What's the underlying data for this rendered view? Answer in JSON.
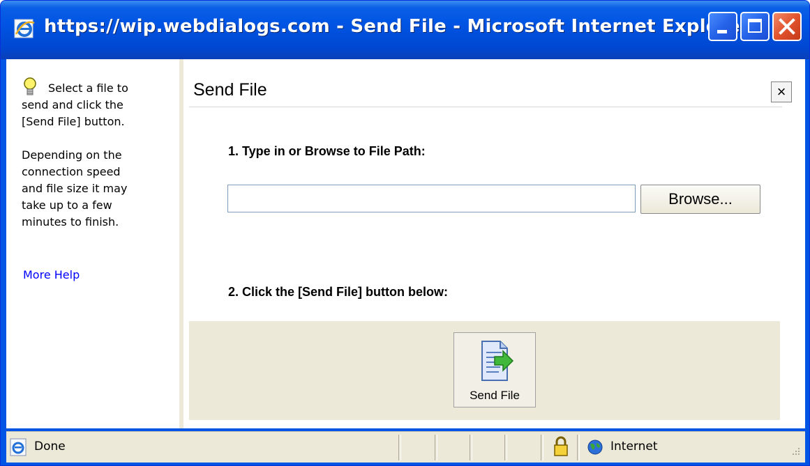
{
  "window": {
    "title": "https://wip.webdialogs.com - Send File - Microsoft Internet Explorer",
    "buttons": [
      "minimize",
      "maximize",
      "close"
    ]
  },
  "sidebar": {
    "help_intro": "Select a file to",
    "help_rest": "send and click the\n[Send File] button.",
    "help_para2": "Depending on the\nconnection speed\nand file size it may\ntake up to a few\nminutes to finish.",
    "more_help_link": "More Help",
    "icon": "lightbulb-icon"
  },
  "dialog": {
    "heading": "Send File",
    "close_label": "×",
    "step1_label": "1. Type in or Browse to File Path:",
    "file_path_value": "",
    "browse_label": "Browse...",
    "step2_label": "2. Click the [Send File] button below:",
    "send_button_label": "Send File",
    "send_icon": "document-arrow-icon"
  },
  "statusbar": {
    "status_text": "Done",
    "zone_text": "Internet",
    "icons": [
      "ie-page-icon",
      "lock-icon",
      "globe-icon"
    ]
  },
  "colors": {
    "titlebar": "#0054e3",
    "chrome": "#ece9d8",
    "link": "#0000ff"
  }
}
